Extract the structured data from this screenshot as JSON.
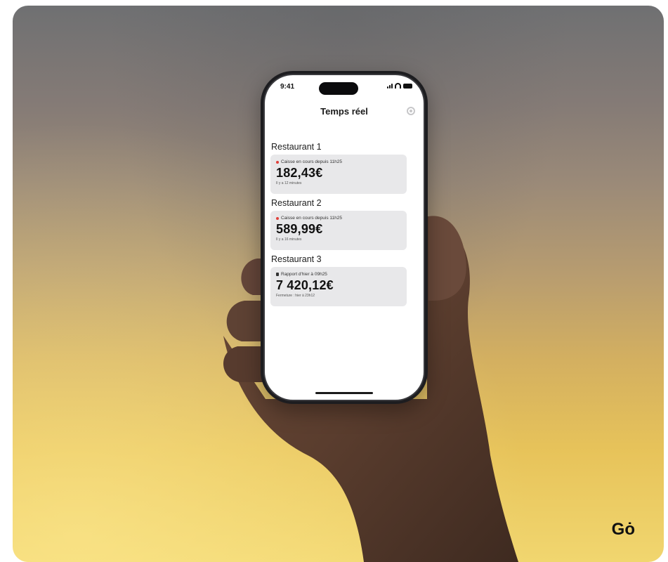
{
  "phone": {
    "status_time": "9:41",
    "title": "Temps réel",
    "settings_icon": "gear-icon",
    "restaurants": [
      {
        "name": "Restaurant 1",
        "status_icon": "red-dot",
        "status": "Caisse en cours depuis 11h25",
        "amount": "182,43€",
        "footnote": "Il y a 12 minutes"
      },
      {
        "name": "Restaurant 2",
        "status_icon": "red-dot",
        "status": "Caisse en cours depuis 11h25",
        "amount": "589,99€",
        "footnote": "Il y a 16 minutes"
      },
      {
        "name": "Restaurant 3",
        "status_icon": "document-icon",
        "status": "Rapport d'hier à 09h25",
        "amount": "7 420,12€",
        "footnote": "Fermeture : hier à 23h12"
      }
    ]
  },
  "brand": "Gȯ",
  "colors": {
    "background_top": "#6f7072",
    "background_bottom": "#f1d66f",
    "tile": "#e8e8ea",
    "live_dot": "#e0403a"
  }
}
